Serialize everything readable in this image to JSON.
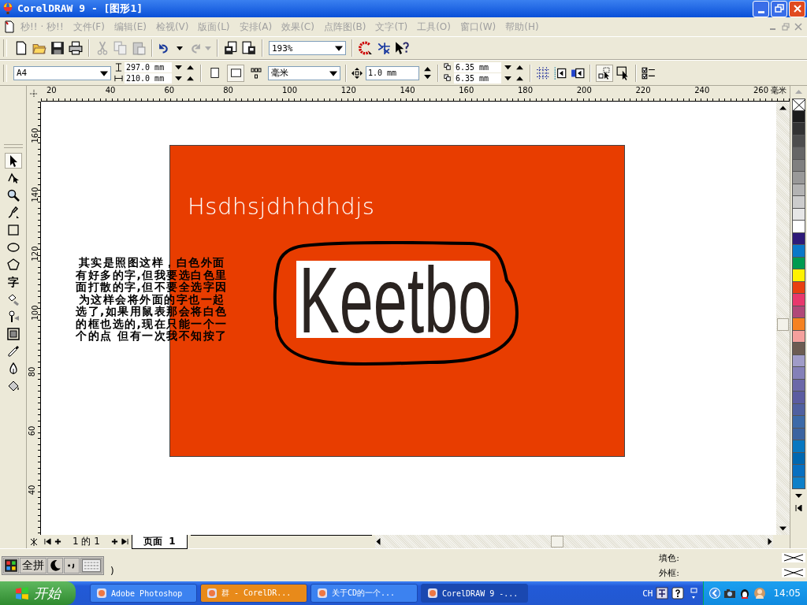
{
  "window": {
    "title": "CorelDRAW 9 - [图形1]"
  },
  "menu": [
    "秒!! · 秒!!",
    "文件(F)",
    "编辑(E)",
    "检视(V)",
    "版面(L)",
    "安排(A)",
    "效果(C)",
    "点阵图(B)",
    "文字(T)",
    "工具(O)",
    "窗口(W)",
    "帮助(H)"
  ],
  "toolbar": {
    "zoom": "193%"
  },
  "property_bar": {
    "page_size": "A4",
    "width": "297.0 mm",
    "height": "210.0 mm",
    "orientation": [
      {
        "kind": "portrait",
        "selected": false
      },
      {
        "kind": "landscape",
        "selected": true
      }
    ],
    "units": "毫米",
    "nudge": "1.0 mm",
    "duplicate_x": "6.35 mm",
    "duplicate_y": "6.35 mm"
  },
  "toolbox": [
    {
      "kind": "pick",
      "selected": true
    },
    {
      "kind": "shape",
      "selected": false
    },
    {
      "kind": "zoom",
      "selected": false
    },
    {
      "kind": "freehand",
      "selected": false
    },
    {
      "kind": "rectangle",
      "selected": false
    },
    {
      "kind": "ellipse",
      "selected": false
    },
    {
      "kind": "polygon",
      "selected": false
    },
    {
      "kind": "text",
      "label": "字",
      "selected": false
    },
    {
      "kind": "interactive-fill",
      "selected": false
    },
    {
      "kind": "eyedropper",
      "selected": false
    },
    {
      "kind": "outline",
      "selected": false
    },
    {
      "kind": "dropper",
      "selected": false
    },
    {
      "kind": "pen",
      "selected": false
    },
    {
      "kind": "bucket",
      "selected": false
    }
  ],
  "ruler": {
    "x_labels": [
      "20",
      "40",
      "60",
      "80",
      "100",
      "120",
      "140",
      "160",
      "180",
      "200",
      "220",
      "240",
      "260"
    ],
    "unit": "毫米",
    "y_labels": [
      "160",
      "140",
      "120",
      "100",
      "80",
      "60",
      "40"
    ]
  },
  "canvas": {
    "heading": "Hsdhsjdhhdhdjs",
    "logo_text": "Keetbo",
    "note_lines": [
      "其实是照图这样，白色外面",
      "有好多的字,但我要选白色里",
      "面打散的字,但不要全选字因",
      "为这样会将外面的字也一起",
      "选了,如果用鼠表那会将白色",
      "的框也选的,现在只能一个一",
      "个的点 但有一次我不知按了"
    ]
  },
  "palette": [
    {
      "color": "#1c1c1c"
    },
    {
      "color": "#333333"
    },
    {
      "color": "#4d4d4d"
    },
    {
      "color": "#666666"
    },
    {
      "color": "#808080"
    },
    {
      "color": "#999999"
    },
    {
      "color": "#b3b3b3"
    },
    {
      "color": "#cccccc"
    },
    {
      "color": "#e6e6e6"
    },
    {
      "color": "#ffffff"
    },
    {
      "color": "#2e1a78"
    },
    {
      "color": "#0a78c8"
    },
    {
      "color": "#009a50"
    },
    {
      "color": "#fff200"
    },
    {
      "color": "#e84010"
    },
    {
      "color": "#e8386c"
    },
    {
      "color": "#b04878"
    },
    {
      "color": "#f58220"
    },
    {
      "color": "#f4a09c"
    },
    {
      "color": "#6c5c52"
    },
    {
      "color": "#a09cc8"
    },
    {
      "color": "#8480b8"
    },
    {
      "color": "#6c68a8"
    },
    {
      "color": "#5c5ca0"
    },
    {
      "color": "#5060a0"
    },
    {
      "color": "#3c6aa8"
    },
    {
      "color": "#3c64a0"
    },
    {
      "color": "#0878c0"
    },
    {
      "color": "#0068b0"
    },
    {
      "color": "#0870c0"
    },
    {
      "color": "#0e80c8"
    }
  ],
  "page_tabs": {
    "counter": "1 的 1",
    "tabs": [
      {
        "label": "页面  1",
        "selected": true
      }
    ]
  },
  "status": {
    "ime": "全拼",
    "message": ")",
    "fill_label": "填色:",
    "outline_label": "外框:"
  },
  "taskbar": {
    "start": "开始",
    "items": [
      {
        "label": "Adobe Photoshop",
        "selected": false,
        "flashing": false
      },
      {
        "label": "群 - CorelDR...",
        "selected": false,
        "flashing": true
      },
      {
        "label": "关于CD的一个...",
        "selected": false,
        "flashing": false
      },
      {
        "label": "CorelDRAW 9 -...",
        "selected": true,
        "flashing": false
      }
    ],
    "language": "CH",
    "clock": "14:05"
  }
}
